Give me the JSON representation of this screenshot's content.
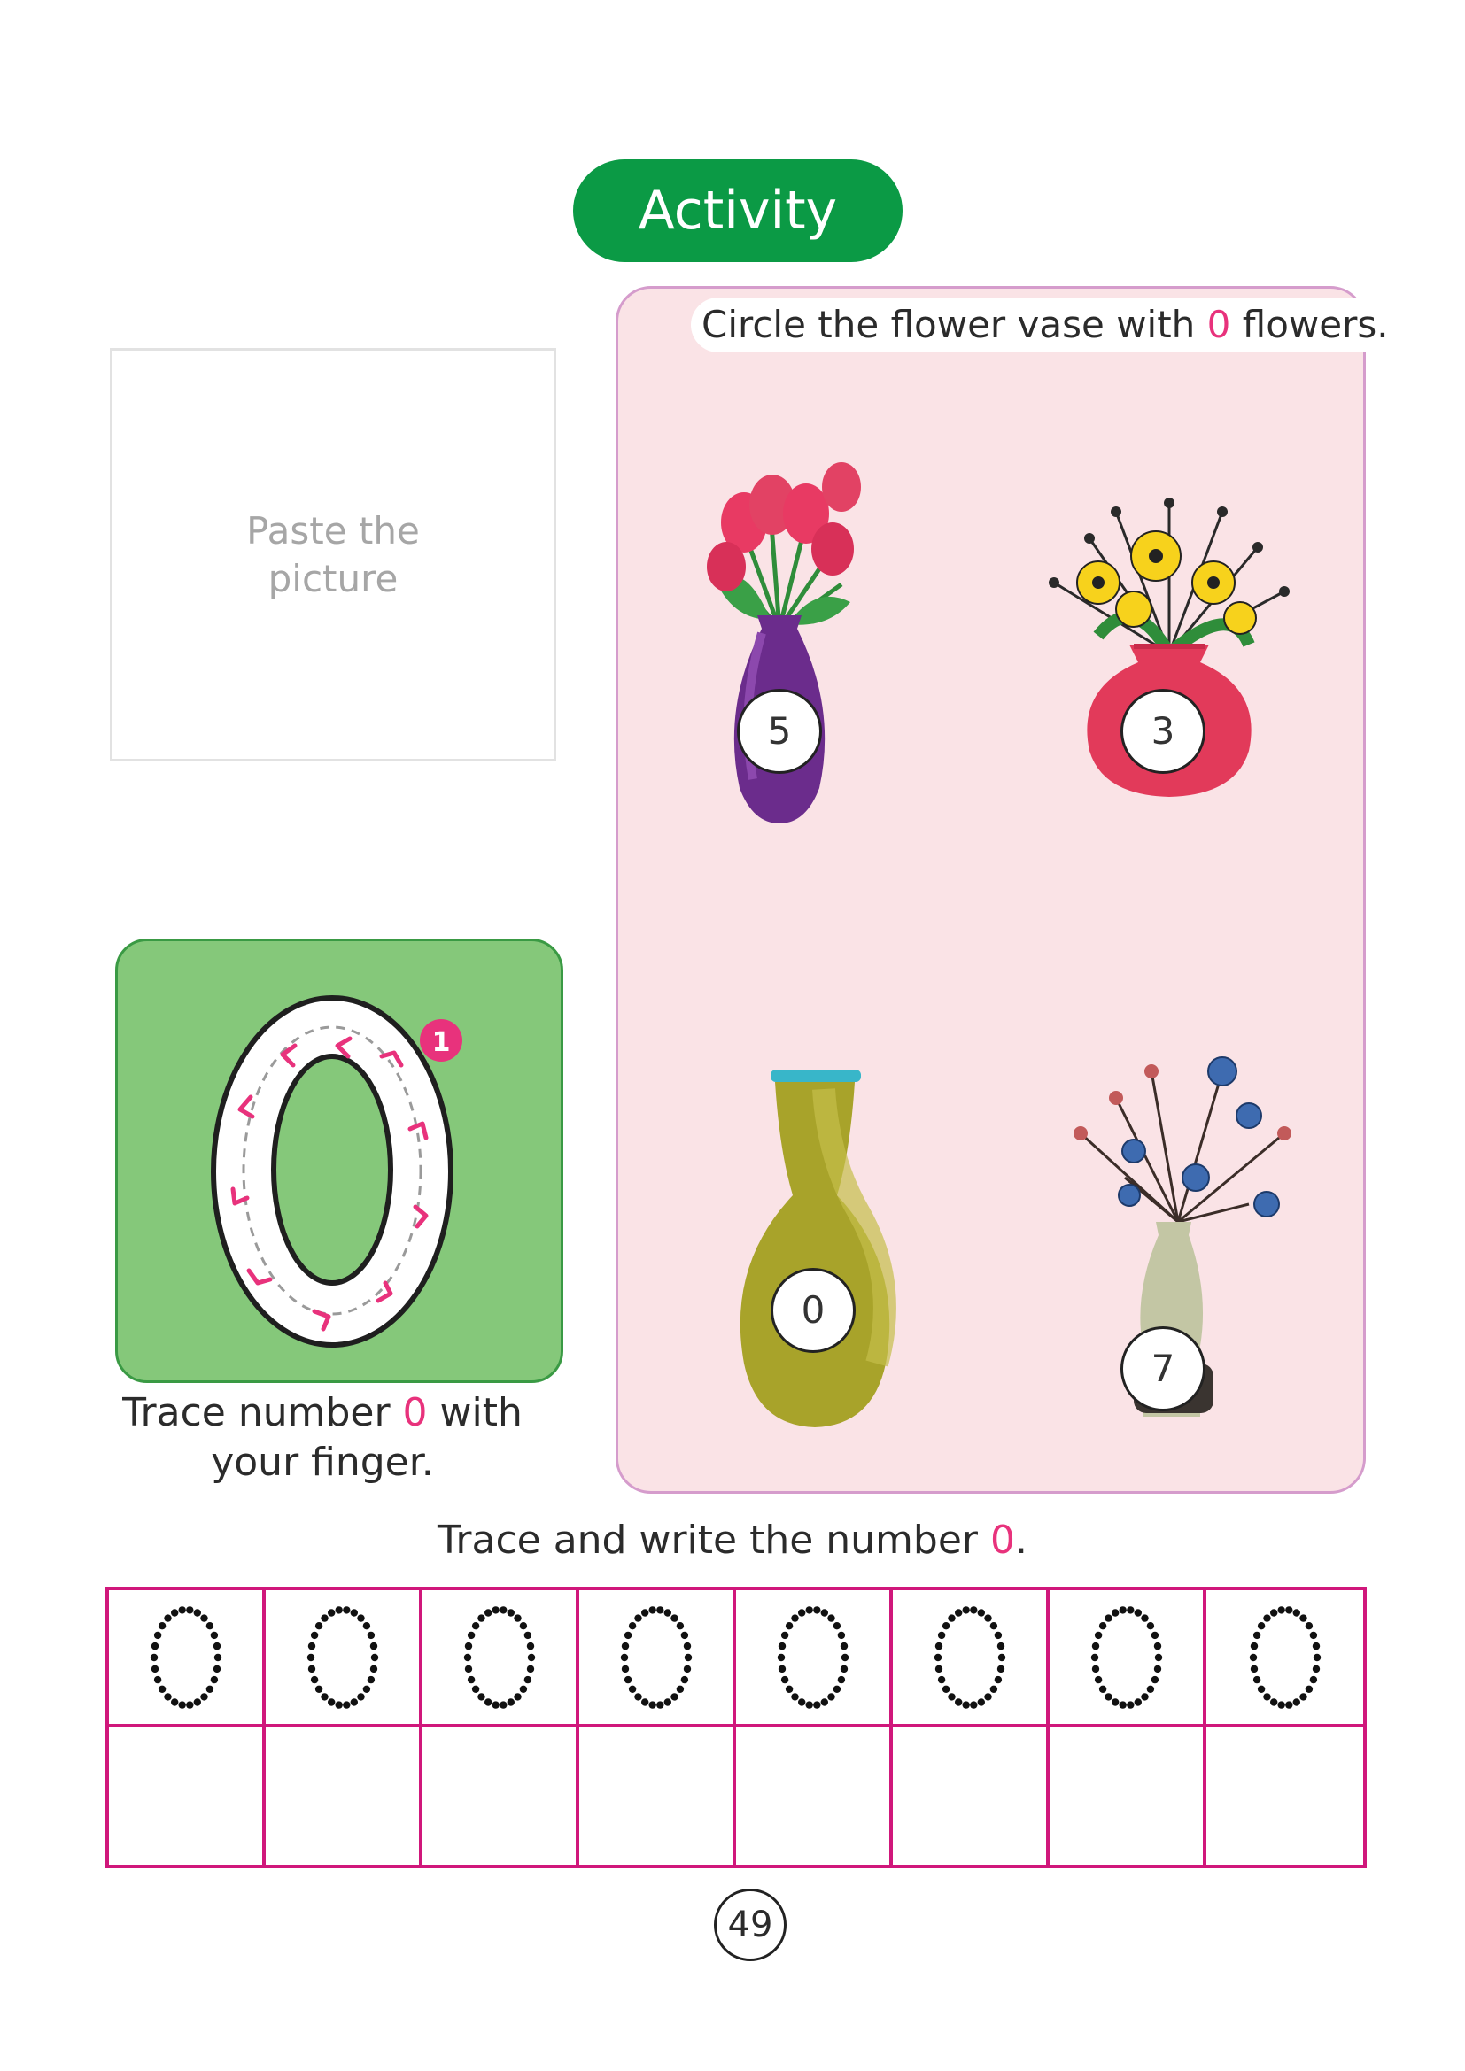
{
  "header": {
    "title": "Activity"
  },
  "paste_box": {
    "label": "Paste the picture"
  },
  "trace_panel": {
    "big_digit": "0",
    "step_badge": "1",
    "caption_before": "Trace number ",
    "caption_digit": "0",
    "caption_after": " with your finger."
  },
  "activity": {
    "instruction_before": "Circle the flower vase with ",
    "instruction_digit": "0",
    "instruction_after": " flowers.",
    "vases": [
      {
        "name": "purple-vase-tulips",
        "number": "5"
      },
      {
        "name": "red-vase-yellow-flowers",
        "number": "3"
      },
      {
        "name": "olive-vase-empty",
        "number": "0"
      },
      {
        "name": "sage-vase-blue-flowers",
        "number": "7"
      }
    ]
  },
  "writing": {
    "instruction_before": "Trace and write the number ",
    "instruction_digit": "0",
    "instruction_after": ".",
    "trace_digit": "0",
    "columns": 8
  },
  "footer": {
    "page_number": "49"
  },
  "colors": {
    "header_green": "#0b9a45",
    "panel_pink": "#fae3e6",
    "grid_magenta": "#d0177b",
    "highlight_pink": "#e8327c",
    "trace_green": "#85c87a"
  }
}
